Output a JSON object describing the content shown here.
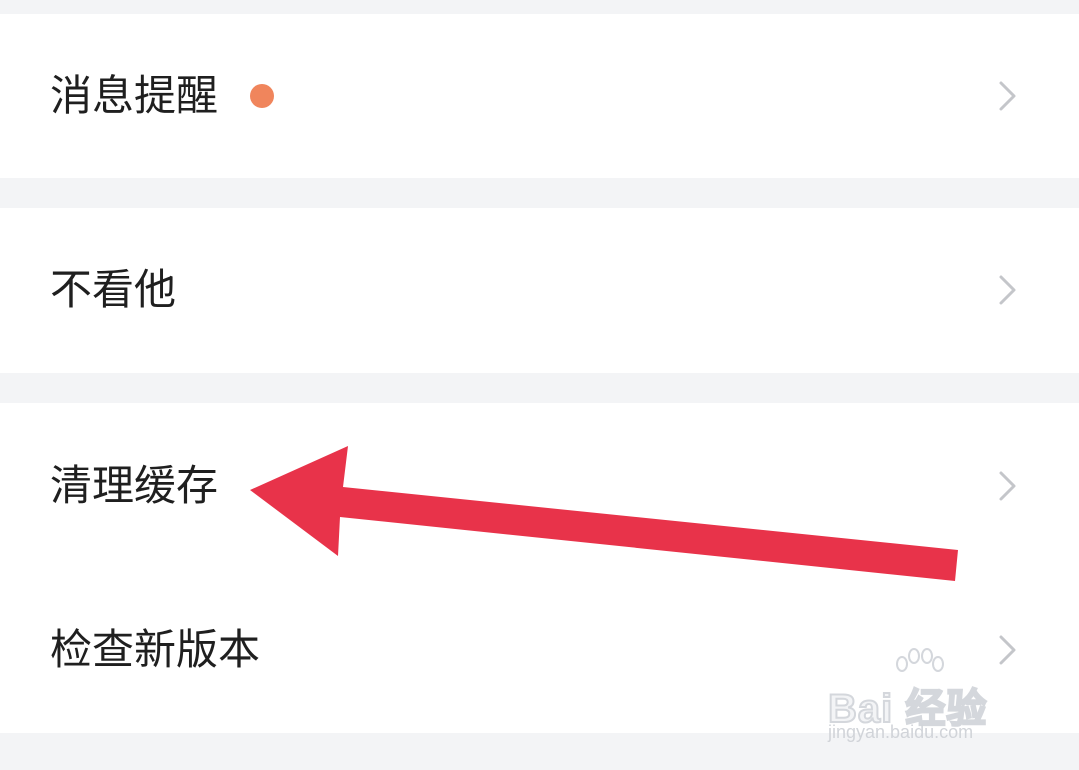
{
  "settings": {
    "rows": [
      {
        "label": "消息提醒",
        "has_badge": true
      },
      {
        "label": "不看他"
      },
      {
        "label": "清理缓存"
      },
      {
        "label": "检查新版本"
      }
    ]
  },
  "colors": {
    "page_background": "#f3f4f6",
    "card_background": "#ffffff",
    "label_text": "#1f1f1f",
    "chevron": "#c4c6ca",
    "badge_dot": "#f0855c",
    "annotation_arrow": "#e8334a"
  },
  "icons": {
    "chevron": "chevron-right-icon",
    "annotation": "annotation-arrow-icon"
  },
  "watermark": {
    "logo_text": "Bai 经验",
    "url": "jingyan.baidu.com"
  }
}
